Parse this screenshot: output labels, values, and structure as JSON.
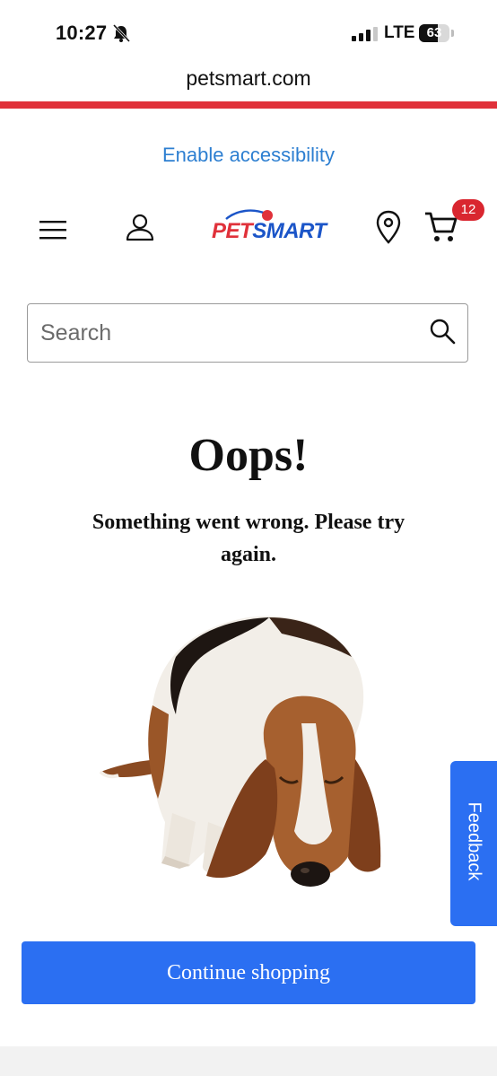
{
  "status_bar": {
    "time": "10:27",
    "network": "LTE",
    "battery": "63",
    "battery_level": 0.63
  },
  "browser": {
    "url": "petsmart.com"
  },
  "accessibility_link": "Enable accessibility",
  "header": {
    "logo_text_pet": "PET",
    "logo_text_smart": "SMART",
    "cart_count": "12"
  },
  "search": {
    "placeholder": "Search"
  },
  "error": {
    "title": "Oops!",
    "message": "Something went wrong. Please try again."
  },
  "feedback_label": "Feedback",
  "continue_label": "Continue shopping",
  "colors": {
    "brand_red": "#e0313a",
    "brand_blue": "#2b6ff2",
    "link_blue": "#2d7fd1"
  }
}
